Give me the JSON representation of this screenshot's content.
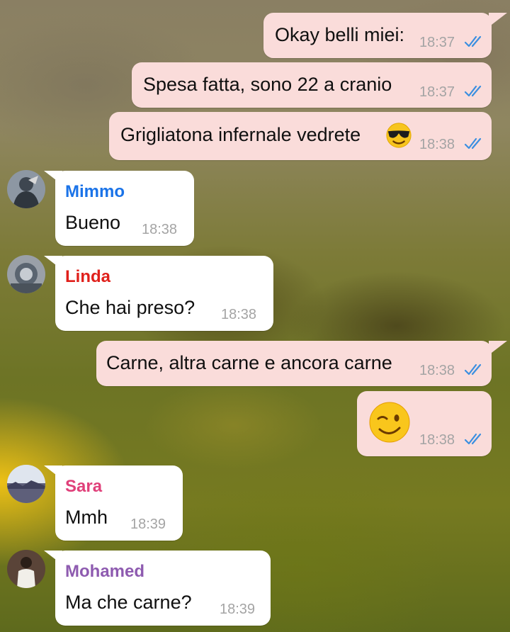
{
  "chat": {
    "messages": [
      {
        "direction": "out",
        "text": "Okay belli miei:",
        "time": "18:37",
        "status": "read"
      },
      {
        "direction": "out",
        "text": "Spesa fatta, sono 22 a cranio",
        "time": "18:37",
        "status": "read"
      },
      {
        "direction": "out",
        "text": "Grigliatona infernale vedrete",
        "emoji": "smiling-face-with-sunglasses",
        "time": "18:38",
        "status": "read"
      },
      {
        "direction": "in",
        "sender": "Mimmo",
        "sender_color": "#1a73e8",
        "text": "Bueno",
        "time": "18:38"
      },
      {
        "direction": "in",
        "sender": "Linda",
        "sender_color": "#e0201b",
        "text": "Che hai preso?",
        "time": "18:38"
      },
      {
        "direction": "out",
        "text": "Carne, altra carne e ancora carne",
        "time": "18:38",
        "status": "read"
      },
      {
        "direction": "out",
        "emoji": "winking-face",
        "time": "18:38",
        "status": "read"
      },
      {
        "direction": "in",
        "sender": "Sara",
        "sender_color": "#e0407a",
        "text": "Mmh",
        "time": "18:39"
      },
      {
        "direction": "in",
        "sender": "Mohamed",
        "sender_color": "#8e5bb0",
        "text": "Ma che carne?",
        "time": "18:39"
      }
    ]
  },
  "colors": {
    "outgoing_bubble": "#fadcda",
    "incoming_bubble": "#ffffff",
    "read_ticks": "#3b8fe0",
    "timestamp": "#a4a4a4"
  }
}
